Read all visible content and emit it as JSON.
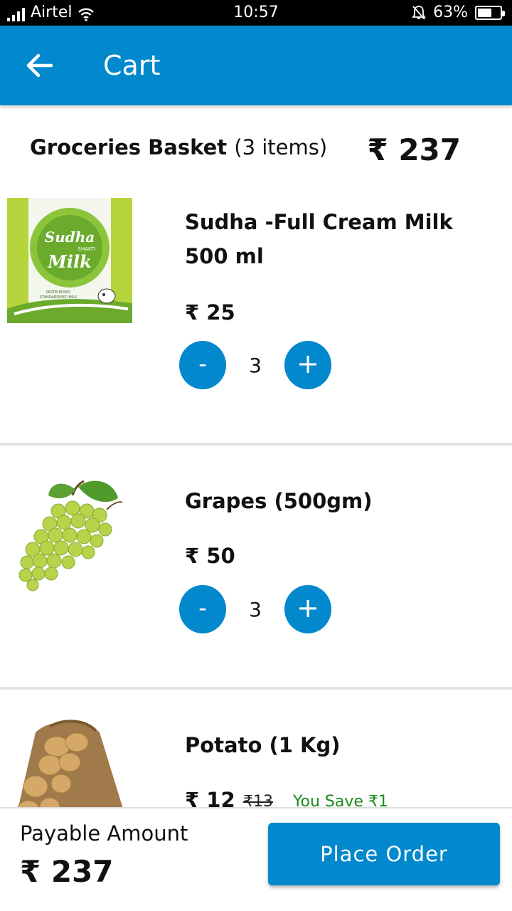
{
  "status_bar": {
    "carrier": "Airtel",
    "time": "10:57",
    "battery": "63%",
    "battery_level": 0.63
  },
  "app_bar": {
    "back_icon": "arrow-left-icon",
    "title": "Cart"
  },
  "basket": {
    "title": "Groceries Basket",
    "count": "(3 items)",
    "total": "₹ 237"
  },
  "items": [
    {
      "name": "Sudha -Full Cream Milk 500 ml",
      "price": "₹ 25",
      "quantity": "3",
      "minus": "-",
      "plus": "+",
      "image": "milk-packet-image"
    },
    {
      "name": "Grapes (500gm)",
      "price": "₹ 50",
      "quantity": "3",
      "minus": "-",
      "plus": "+",
      "image": "grapes-image"
    },
    {
      "name": "Potato (1 Kg)",
      "price": "₹ 12",
      "mrp": "₹13",
      "savings": "You Save ₹1",
      "image": "potato-sack-image"
    }
  ],
  "milk_packet_text": {
    "brand": "Sudha",
    "sub": "SHAKTI",
    "product": "Milk",
    "line1": "PASTEURISED",
    "line2": "STANDARDISED MILK"
  },
  "footer": {
    "payable_label": "Payable Amount",
    "payable_amount": "₹ 237",
    "place_order": "Place Order"
  },
  "colors": {
    "primary": "#0288cc",
    "save_green": "#1e8a1e"
  }
}
